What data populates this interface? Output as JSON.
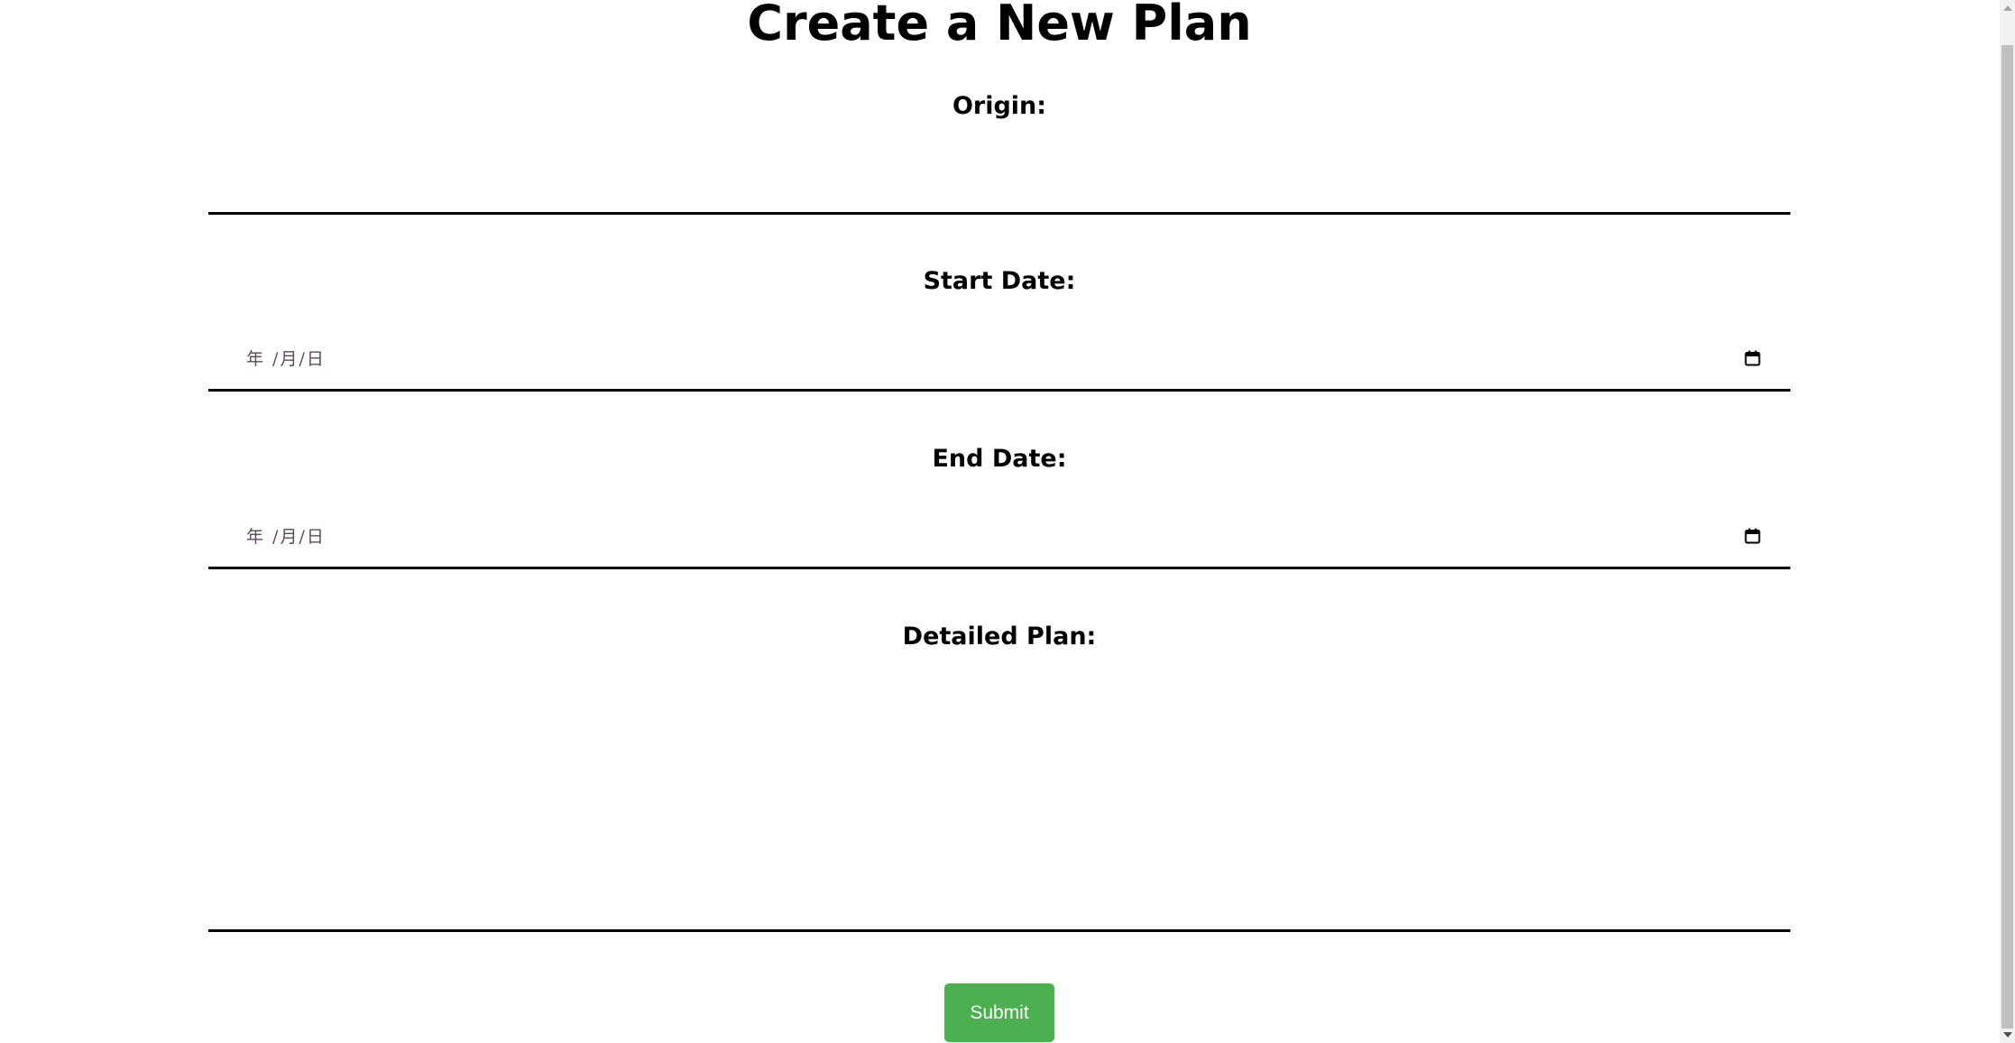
{
  "page": {
    "title": "Create a New Plan"
  },
  "form": {
    "origin": {
      "label": "Origin:",
      "value": ""
    },
    "start_date": {
      "label": "Start Date:",
      "placeholder": "年 /月/日",
      "icon": "calendar-icon"
    },
    "end_date": {
      "label": "End Date:",
      "placeholder": "年 /月/日",
      "icon": "calendar-icon"
    },
    "detailed_plan": {
      "label": "Detailed Plan:",
      "value": ""
    },
    "submit_label": "Submit"
  },
  "colors": {
    "submit_background": "#4caf50",
    "submit_text": "#ffffff",
    "field_underline": "#000000"
  }
}
